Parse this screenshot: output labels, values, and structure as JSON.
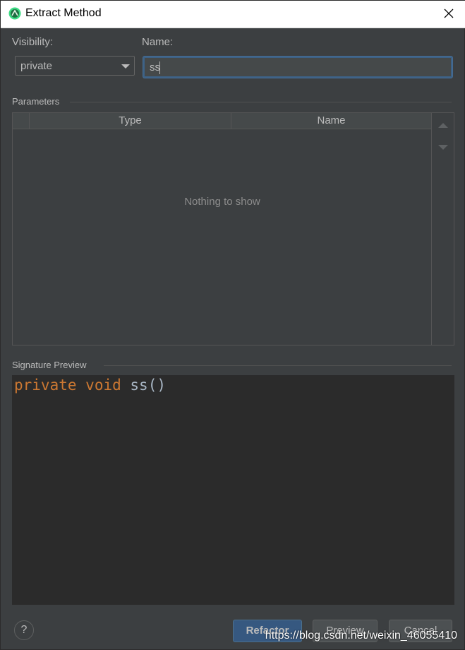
{
  "window": {
    "title": "Extract Method"
  },
  "visibility": {
    "label": "Visibility:",
    "value": "private"
  },
  "name": {
    "label": "Name:",
    "value": "ss"
  },
  "parameters": {
    "section_title": "Parameters",
    "columns": [
      "Type",
      "Name"
    ],
    "empty_text": "Nothing to show"
  },
  "signature_preview": {
    "section_title": "Signature Preview",
    "kw1": "private",
    "kw2": "void",
    "method": "ss()"
  },
  "buttons": {
    "help": "?",
    "refactor": "Refactor",
    "preview": "Preview",
    "cancel": "Cancel"
  },
  "watermark": "https://blog.csdn.net/weixin_46055410",
  "colors": {
    "background": "#3c3f41",
    "editor_background": "#2b2b2b",
    "keyword": "#cc7832",
    "identifier": "#a9b7c6",
    "primary_button": "#365880",
    "focus_border": "#3d6185"
  }
}
